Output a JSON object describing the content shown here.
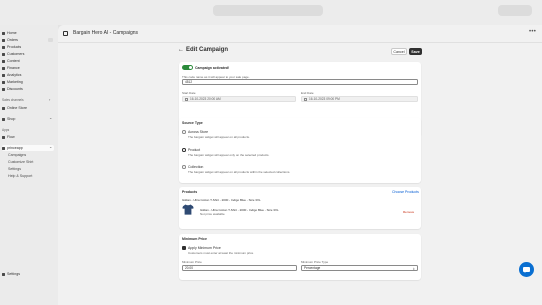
{
  "sidebar": {
    "items": [
      {
        "label": "Home",
        "icon": "home-icon"
      },
      {
        "label": "Orders",
        "icon": "orders-icon"
      },
      {
        "label": "Products",
        "icon": "tag-icon"
      },
      {
        "label": "Customers",
        "icon": "person-icon"
      },
      {
        "label": "Content",
        "icon": "content-icon"
      },
      {
        "label": "Finance",
        "icon": "bank-icon"
      },
      {
        "label": "Analytics",
        "icon": "chart-icon"
      },
      {
        "label": "Marketing",
        "icon": "target-icon"
      },
      {
        "label": "Discounts",
        "icon": "discount-icon"
      }
    ],
    "sales_channels_label": "Sales channels",
    "online_store": "Online Store",
    "shop": "Shop",
    "apps_label": "Apps",
    "flow": "Flow",
    "app_name": "princeapp",
    "app_sub_items": [
      "Campaigns",
      "Customize Shirt",
      "Settings",
      "Help & Support"
    ],
    "settings": "Settings"
  },
  "app_header": {
    "title": "Bargain Hero AI - Campaigns",
    "more": "•••"
  },
  "page": {
    "title": "Edit Campaign",
    "cancel_label": "Cancel",
    "save_label": "Save"
  },
  "activation": {
    "status_label": "Campaign activated!",
    "help_text": "This code name as it will appear to your sale page.",
    "code_value": "4512",
    "start_label": "Start Date",
    "start_value": "16-10-2023 20:00 AM",
    "end_label": "End Date",
    "end_value": "16-10-2023 09:00 PM"
  },
  "source": {
    "title": "Source Type",
    "options": [
      {
        "label": "Across Store",
        "desc": "The bargain widget will appear on all products.",
        "selected": false
      },
      {
        "label": "Product",
        "desc": "The bargain widget will appear only on the selected products.",
        "selected": true
      },
      {
        "label": "Collection",
        "desc": "The bargain widget will appear on all products within the selected collections.",
        "selected": false
      }
    ]
  },
  "products": {
    "title": "Products",
    "choose_label": "Choose Products",
    "product_heading": "Gildan - Ultra Cotton T-Shirt - 2000 - Indigo Blue - Size 3XL",
    "item_name": "Gildan - Ultra Cotton T-Shirt - 2000 - Indigo Blue - Size 3XL",
    "item_sub": "Not price available",
    "remove_label": "Remove"
  },
  "minimum_price": {
    "title": "Minimum Price",
    "checkbox_label": "Apply Minimum Price",
    "checkbox_desc": "Customers must enter at least the minimum price",
    "price_label": "Minimum Price",
    "price_value": "20.00",
    "type_label": "Minimum Price Type",
    "type_value": "Percentage"
  },
  "colors": {
    "accent_green": "#2a8a3a",
    "link_blue": "#005bd3",
    "remove_red": "#c5280c",
    "chat_blue": "#0a6fd1"
  }
}
